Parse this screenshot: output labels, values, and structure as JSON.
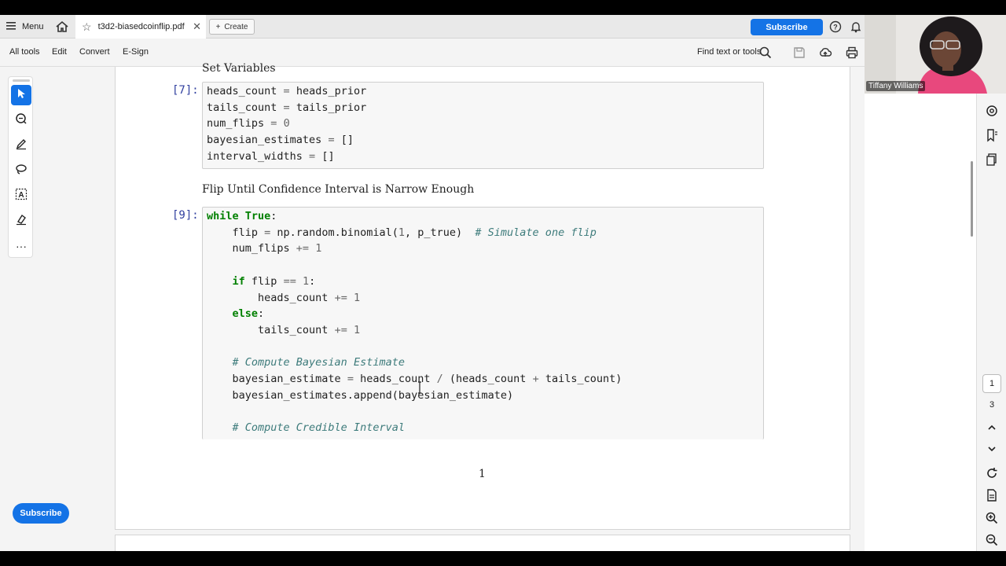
{
  "tabbar": {
    "menu_label": "Menu",
    "doc_tab_title": "t3d2-biasedcoinflip.pdf",
    "create_label": "Create",
    "subscribe_label": "Subscribe"
  },
  "toolbar": {
    "items": [
      "All tools",
      "Edit",
      "Convert",
      "E-Sign"
    ],
    "find_label": "Find text or tools"
  },
  "left_rail": {
    "subscribe_label": "Subscribe"
  },
  "document": {
    "section_cut": "Set Variables",
    "cell1_prompt": "[7]:",
    "section_title": "Flip Until Confidence Interval is Narrow Enough",
    "cell2_prompt": "[9]:",
    "page_number": "1"
  },
  "page_nav": {
    "current": "1",
    "total": "3"
  },
  "webcam": {
    "name": "Tiffany Williams"
  },
  "colors": {
    "accent": "#1473e6",
    "keyword": "#008000",
    "comment": "#3d7b7b",
    "prompt": "#303f9f"
  }
}
